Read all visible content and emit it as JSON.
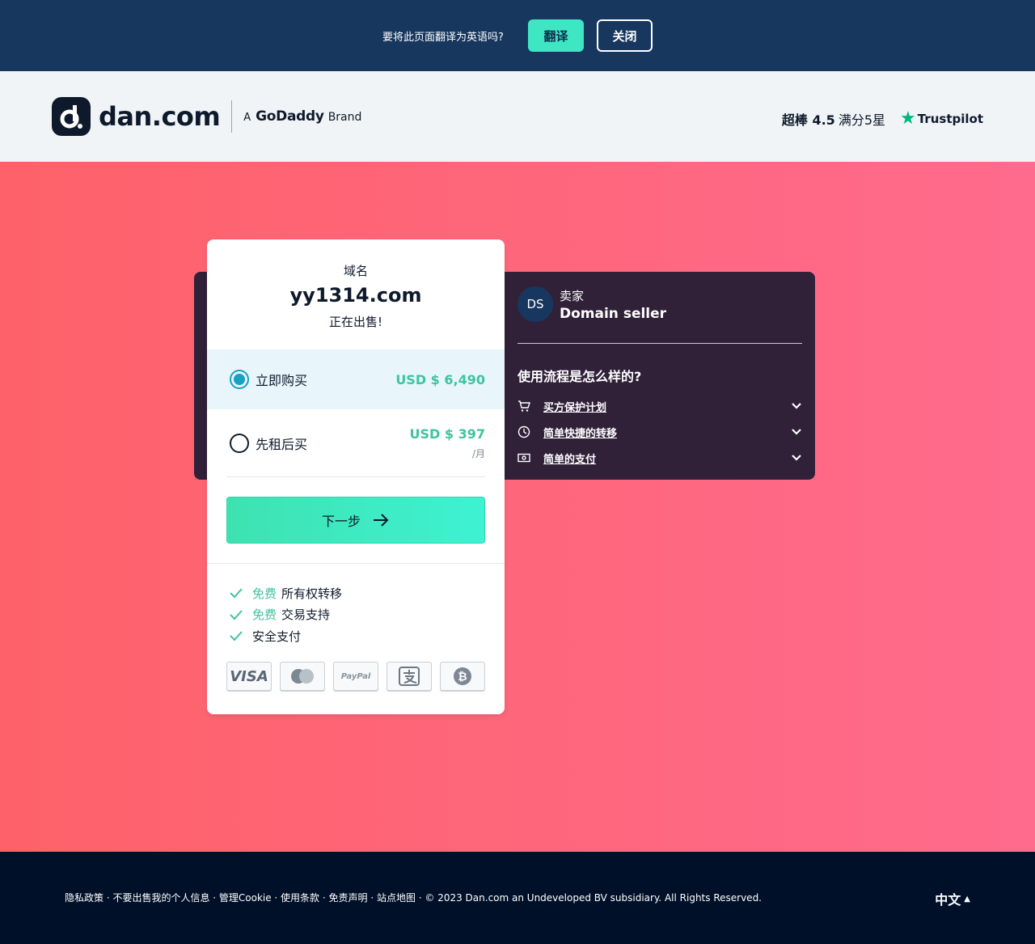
{
  "translate_bar": {
    "question": "要将此页面翻译为英语吗?",
    "translate_label": "翻译",
    "close_label": "关闭"
  },
  "header": {
    "logo_text": "dan.com",
    "brand_a": "A",
    "brand_name": "GoDaddy",
    "brand_suffix": "Brand",
    "rating_strong": "超棒 4.5",
    "rating_rest": "满分5星",
    "trustpilot": "Trustpilot"
  },
  "card": {
    "label": "域名",
    "domain": "yy1314.com",
    "status": "正在出售!",
    "options": [
      {
        "label": "立即购买",
        "price": "USD $ 6,490",
        "per": "",
        "selected": true
      },
      {
        "label": "先租后买",
        "price": "USD $ 397",
        "per": "/月",
        "selected": false
      }
    ],
    "next_label": "下一步",
    "features": [
      {
        "free": "免费",
        "text": "所有权转移"
      },
      {
        "free": "免费",
        "text": "交易支持"
      },
      {
        "free": "",
        "text": "安全支付"
      }
    ],
    "payment_methods": [
      "VISA",
      "mastercard-icon",
      "PayPal",
      "alipay-icon",
      "bitcoin-icon"
    ]
  },
  "seller": {
    "initials": "DS",
    "role": "卖家",
    "name": "Domain seller"
  },
  "how": {
    "title": "使用流程是怎么样的?",
    "items": [
      {
        "label": "买方保护计划",
        "icon": "cart-icon"
      },
      {
        "label": "简单快捷的转移",
        "icon": "clock-icon"
      },
      {
        "label": "简单的支付",
        "icon": "cash-icon"
      }
    ]
  },
  "footer": {
    "links": "隐私政策 · 不要出售我的个人信息 · 管理Cookie · 使用条款 · 免责声明 · 站点地图 · © 2023 Dan.com an Undeveloped BV subsidiary. All Rights Reserved.",
    "language": "中文"
  },
  "colors": {
    "translate_bar": "#17375e",
    "accent_green": "#3ec49e",
    "dark_card": "#302139",
    "footer": "#001028"
  }
}
